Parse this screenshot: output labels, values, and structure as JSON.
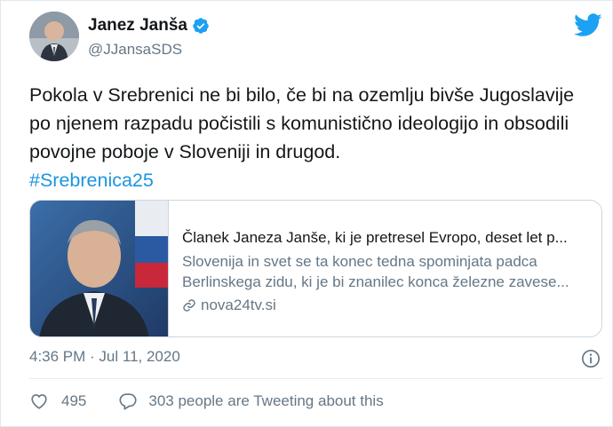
{
  "author": {
    "name": "Janez Janša",
    "handle": "@JJansaSDS",
    "verified": true
  },
  "tweet": {
    "text": "Pokola v Srebrenici ne bi bilo, če bi na ozemlju bivše Jugoslavije po njenem razpadu počistili s komunistično ideologijo in obsodili povojne poboje v Sloveniji in drugod.",
    "hashtag": "#Srebrenica25"
  },
  "card": {
    "title": "Članek Janeza Janše, ki je pretresel Evropo, deset let p...",
    "description_line1": "Slovenija in svet se ta konec tedna spominjata padca",
    "description_line2": "Berlinskega zidu, ki je bi znanilec konca železne zavese...",
    "domain": "nova24tv.si"
  },
  "meta": {
    "timestamp": "4:36 PM · Jul 11, 2020"
  },
  "actions": {
    "like_count": "495",
    "reply_text": "303 people are Tweeting about this"
  },
  "colors": {
    "brand_blue": "#1da1f2",
    "link_blue": "#1b95e0",
    "secondary_text": "#657786"
  },
  "icons": [
    "twitter-bird-icon",
    "verified-badge-icon",
    "link-icon",
    "info-icon",
    "heart-icon",
    "reply-bubble-icon"
  ]
}
